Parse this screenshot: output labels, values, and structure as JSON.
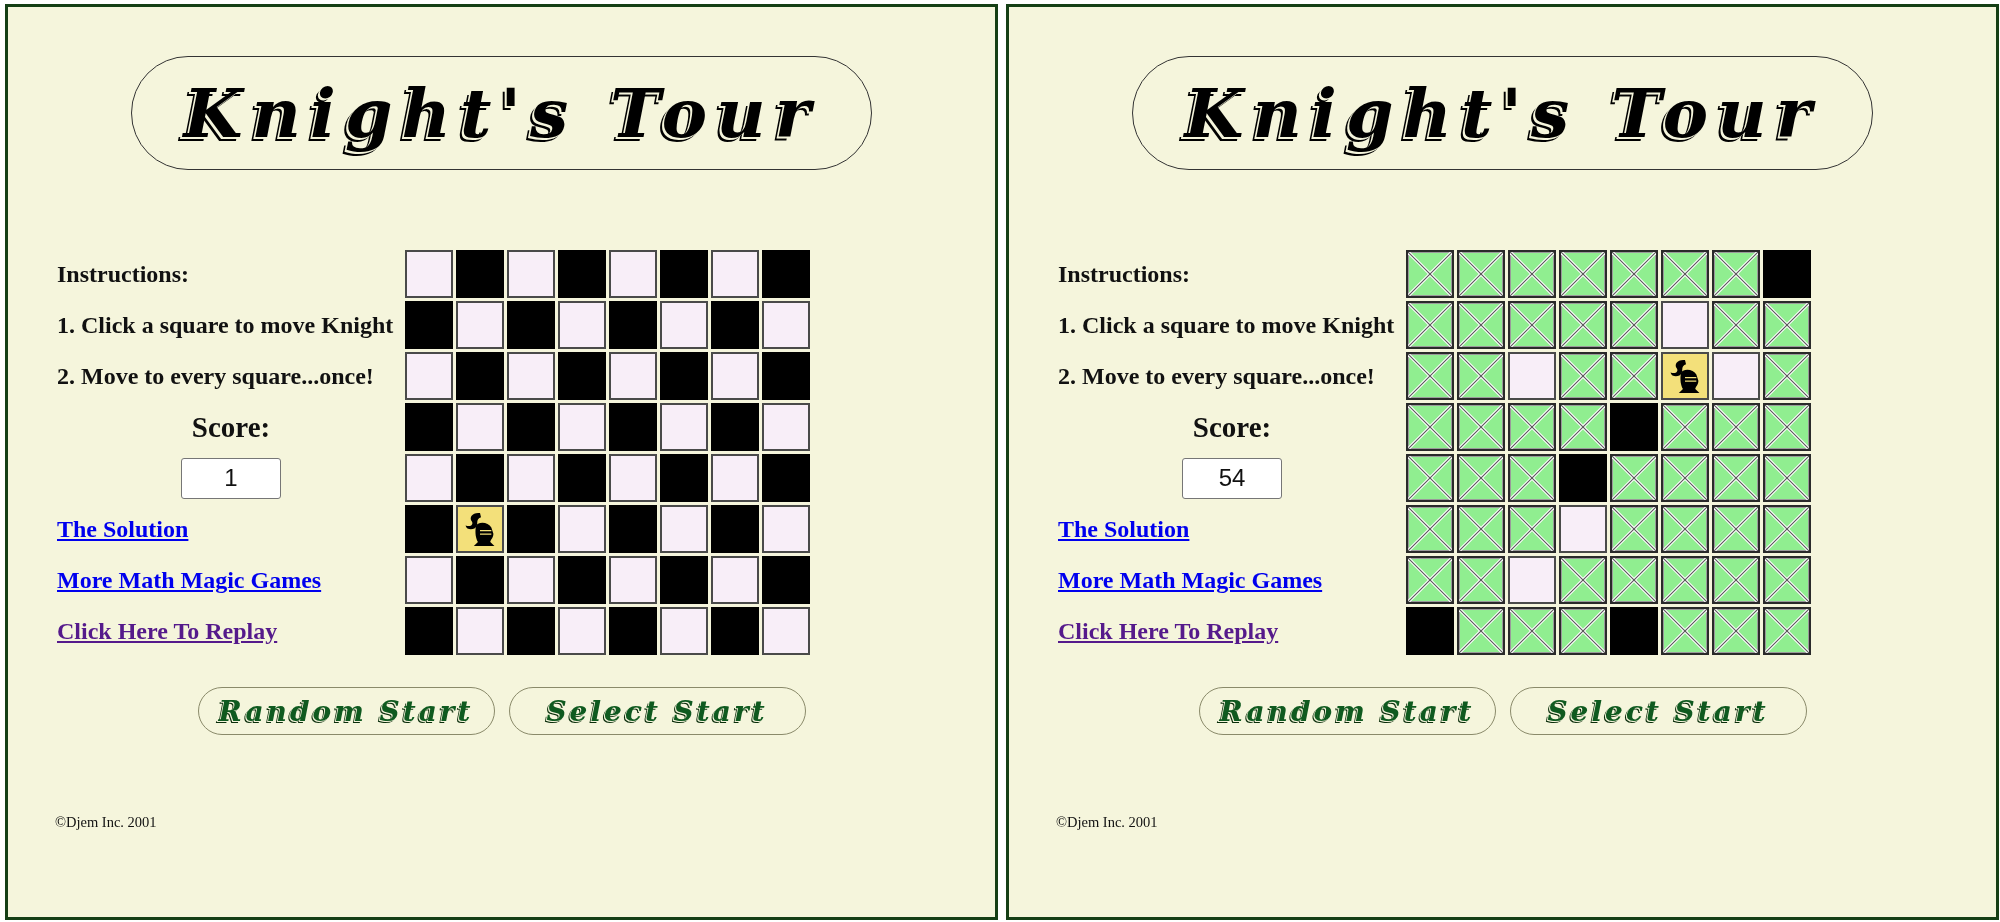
{
  "panels": [
    {
      "title": "Knight's Tour",
      "instructions": {
        "heading": "Instructions:",
        "steps": [
          "1. Click a square to move Knight",
          "2. Move to every square...once!"
        ]
      },
      "score": {
        "label": "Score:",
        "value": "1"
      },
      "links": [
        {
          "text": "The Solution",
          "visited": false
        },
        {
          "text": "More Math Magic Games",
          "visited": false
        },
        {
          "text": "Click Here To Replay",
          "visited": true
        }
      ],
      "board": [
        [
          {
            "kind": "light"
          },
          {
            "kind": "dark"
          },
          {
            "kind": "light"
          },
          {
            "kind": "dark"
          },
          {
            "kind": "light"
          },
          {
            "kind": "dark"
          },
          {
            "kind": "light"
          },
          {
            "kind": "dark"
          }
        ],
        [
          {
            "kind": "dark"
          },
          {
            "kind": "light"
          },
          {
            "kind": "dark"
          },
          {
            "kind": "light"
          },
          {
            "kind": "dark"
          },
          {
            "kind": "light"
          },
          {
            "kind": "dark"
          },
          {
            "kind": "light"
          }
        ],
        [
          {
            "kind": "light"
          },
          {
            "kind": "dark"
          },
          {
            "kind": "light"
          },
          {
            "kind": "dark"
          },
          {
            "kind": "light"
          },
          {
            "kind": "dark"
          },
          {
            "kind": "light"
          },
          {
            "kind": "dark"
          }
        ],
        [
          {
            "kind": "dark"
          },
          {
            "kind": "light"
          },
          {
            "kind": "dark"
          },
          {
            "kind": "light"
          },
          {
            "kind": "dark"
          },
          {
            "kind": "light"
          },
          {
            "kind": "dark"
          },
          {
            "kind": "light"
          }
        ],
        [
          {
            "kind": "light"
          },
          {
            "kind": "dark"
          },
          {
            "kind": "light"
          },
          {
            "kind": "dark"
          },
          {
            "kind": "light"
          },
          {
            "kind": "dark"
          },
          {
            "kind": "light"
          },
          {
            "kind": "dark"
          }
        ],
        [
          {
            "kind": "dark"
          },
          {
            "kind": "knight"
          },
          {
            "kind": "dark"
          },
          {
            "kind": "light"
          },
          {
            "kind": "dark"
          },
          {
            "kind": "light"
          },
          {
            "kind": "dark"
          },
          {
            "kind": "light"
          }
        ],
        [
          {
            "kind": "light"
          },
          {
            "kind": "dark"
          },
          {
            "kind": "light"
          },
          {
            "kind": "dark"
          },
          {
            "kind": "light"
          },
          {
            "kind": "dark"
          },
          {
            "kind": "light"
          },
          {
            "kind": "dark"
          }
        ],
        [
          {
            "kind": "dark"
          },
          {
            "kind": "light"
          },
          {
            "kind": "dark"
          },
          {
            "kind": "light"
          },
          {
            "kind": "dark"
          },
          {
            "kind": "light"
          },
          {
            "kind": "dark"
          },
          {
            "kind": "light"
          }
        ]
      ],
      "buttons": [
        "Random Start",
        "Select Start"
      ],
      "copyright": "©Djem Inc. 2001"
    },
    {
      "title": "Knight's Tour",
      "instructions": {
        "heading": "Instructions:",
        "steps": [
          "1. Click a square to move Knight",
          "2. Move to every square...once!"
        ]
      },
      "score": {
        "label": "Score:",
        "value": "54"
      },
      "links": [
        {
          "text": "The Solution",
          "visited": false
        },
        {
          "text": "More Math Magic Games",
          "visited": false
        },
        {
          "text": "Click Here To Replay",
          "visited": true
        }
      ],
      "board": [
        [
          {
            "kind": "visited"
          },
          {
            "kind": "visited"
          },
          {
            "kind": "visited"
          },
          {
            "kind": "visited"
          },
          {
            "kind": "visited"
          },
          {
            "kind": "visited"
          },
          {
            "kind": "visited"
          },
          {
            "kind": "dark"
          }
        ],
        [
          {
            "kind": "visited"
          },
          {
            "kind": "visited"
          },
          {
            "kind": "visited"
          },
          {
            "kind": "visited"
          },
          {
            "kind": "visited"
          },
          {
            "kind": "light"
          },
          {
            "kind": "visited"
          },
          {
            "kind": "visited"
          }
        ],
        [
          {
            "kind": "visited"
          },
          {
            "kind": "visited"
          },
          {
            "kind": "light"
          },
          {
            "kind": "visited"
          },
          {
            "kind": "visited"
          },
          {
            "kind": "knight"
          },
          {
            "kind": "light"
          },
          {
            "kind": "visited"
          }
        ],
        [
          {
            "kind": "visited"
          },
          {
            "kind": "visited"
          },
          {
            "kind": "visited"
          },
          {
            "kind": "visited"
          },
          {
            "kind": "dark"
          },
          {
            "kind": "visited"
          },
          {
            "kind": "visited"
          },
          {
            "kind": "visited"
          }
        ],
        [
          {
            "kind": "visited"
          },
          {
            "kind": "visited"
          },
          {
            "kind": "visited"
          },
          {
            "kind": "dark"
          },
          {
            "kind": "visited"
          },
          {
            "kind": "visited"
          },
          {
            "kind": "visited"
          },
          {
            "kind": "visited"
          }
        ],
        [
          {
            "kind": "visited"
          },
          {
            "kind": "visited"
          },
          {
            "kind": "visited"
          },
          {
            "kind": "light"
          },
          {
            "kind": "visited"
          },
          {
            "kind": "visited"
          },
          {
            "kind": "visited"
          },
          {
            "kind": "visited"
          }
        ],
        [
          {
            "kind": "visited"
          },
          {
            "kind": "visited"
          },
          {
            "kind": "light"
          },
          {
            "kind": "visited"
          },
          {
            "kind": "visited"
          },
          {
            "kind": "visited"
          },
          {
            "kind": "visited"
          },
          {
            "kind": "visited"
          }
        ],
        [
          {
            "kind": "dark"
          },
          {
            "kind": "visited"
          },
          {
            "kind": "visited"
          },
          {
            "kind": "visited"
          },
          {
            "kind": "dark"
          },
          {
            "kind": "visited"
          },
          {
            "kind": "visited"
          },
          {
            "kind": "visited"
          }
        ]
      ],
      "buttons": [
        "Random Start",
        "Select Start"
      ],
      "copyright": "©Djem Inc. 2001"
    }
  ]
}
